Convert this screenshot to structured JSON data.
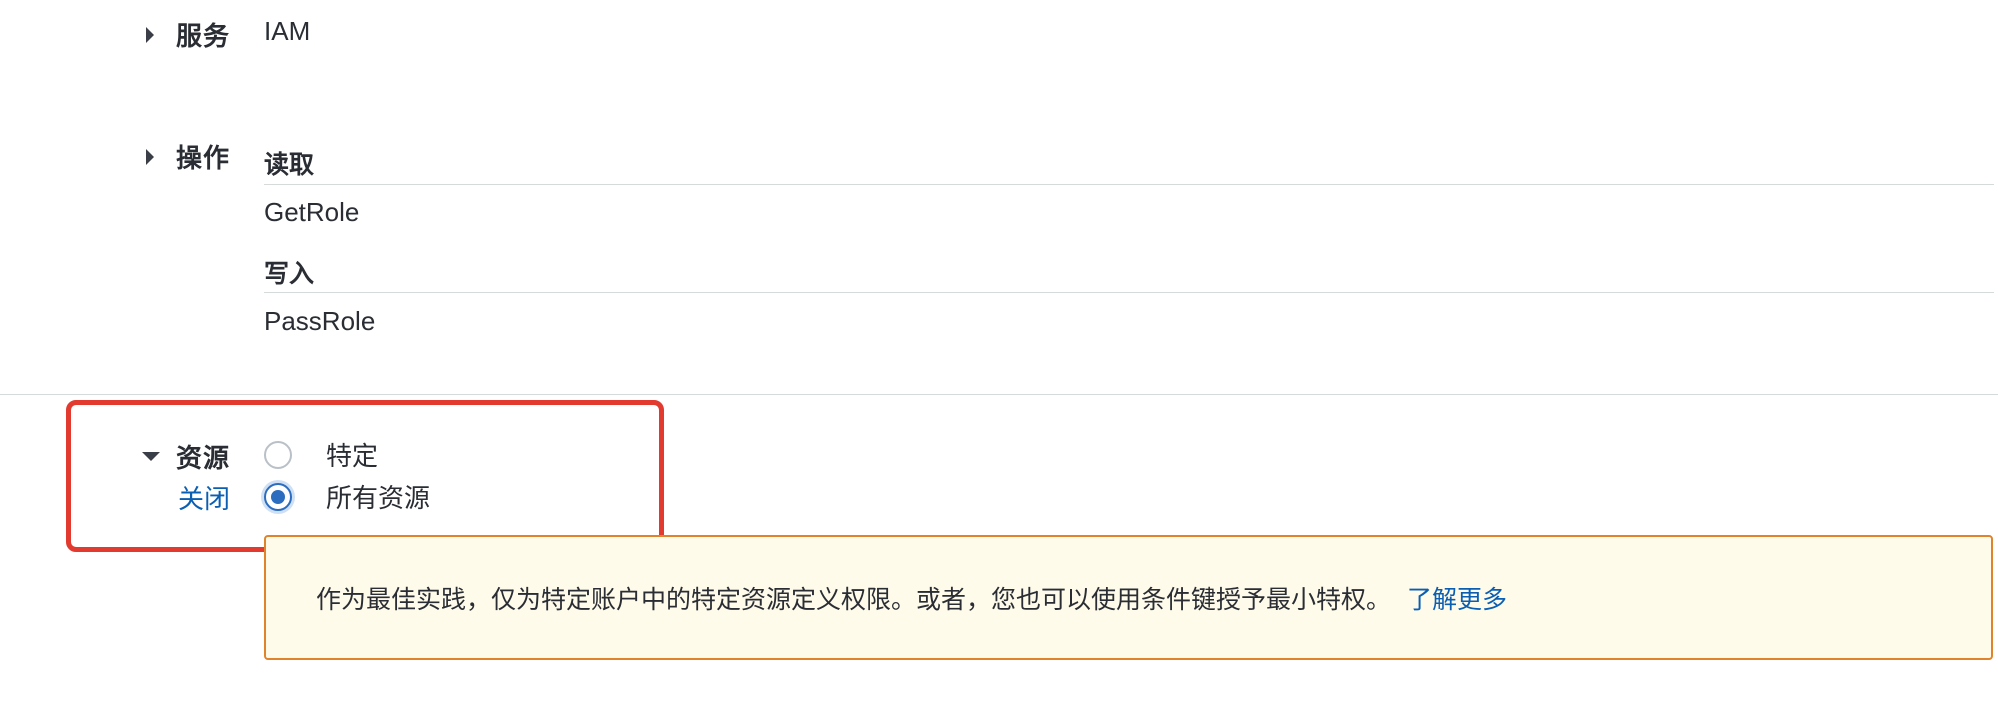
{
  "service": {
    "label": "服务",
    "value": "IAM"
  },
  "actions": {
    "label": "操作",
    "groups": [
      {
        "heading": "读取",
        "items": [
          "GetRole"
        ]
      },
      {
        "heading": "写入",
        "items": [
          "PassRole"
        ]
      }
    ]
  },
  "resources": {
    "label": "资源",
    "close_link": "关闭",
    "options": [
      {
        "label": "特定",
        "selected": false
      },
      {
        "label": "所有资源",
        "selected": true
      }
    ]
  },
  "alert": {
    "text": "作为最佳实践，仅为特定账户中的特定资源定义权限。或者，您也可以使用条件键授予最小特权。",
    "link": "了解更多"
  },
  "colors": {
    "link": "#0b5fb3",
    "radio_selected": "#2d6dbf",
    "highlight_border": "#e23a2e",
    "alert_border": "#e0832b",
    "alert_background": "#fffbeb"
  },
  "icons": {
    "collapsed": "caret-right-icon",
    "expanded": "caret-down-icon"
  }
}
